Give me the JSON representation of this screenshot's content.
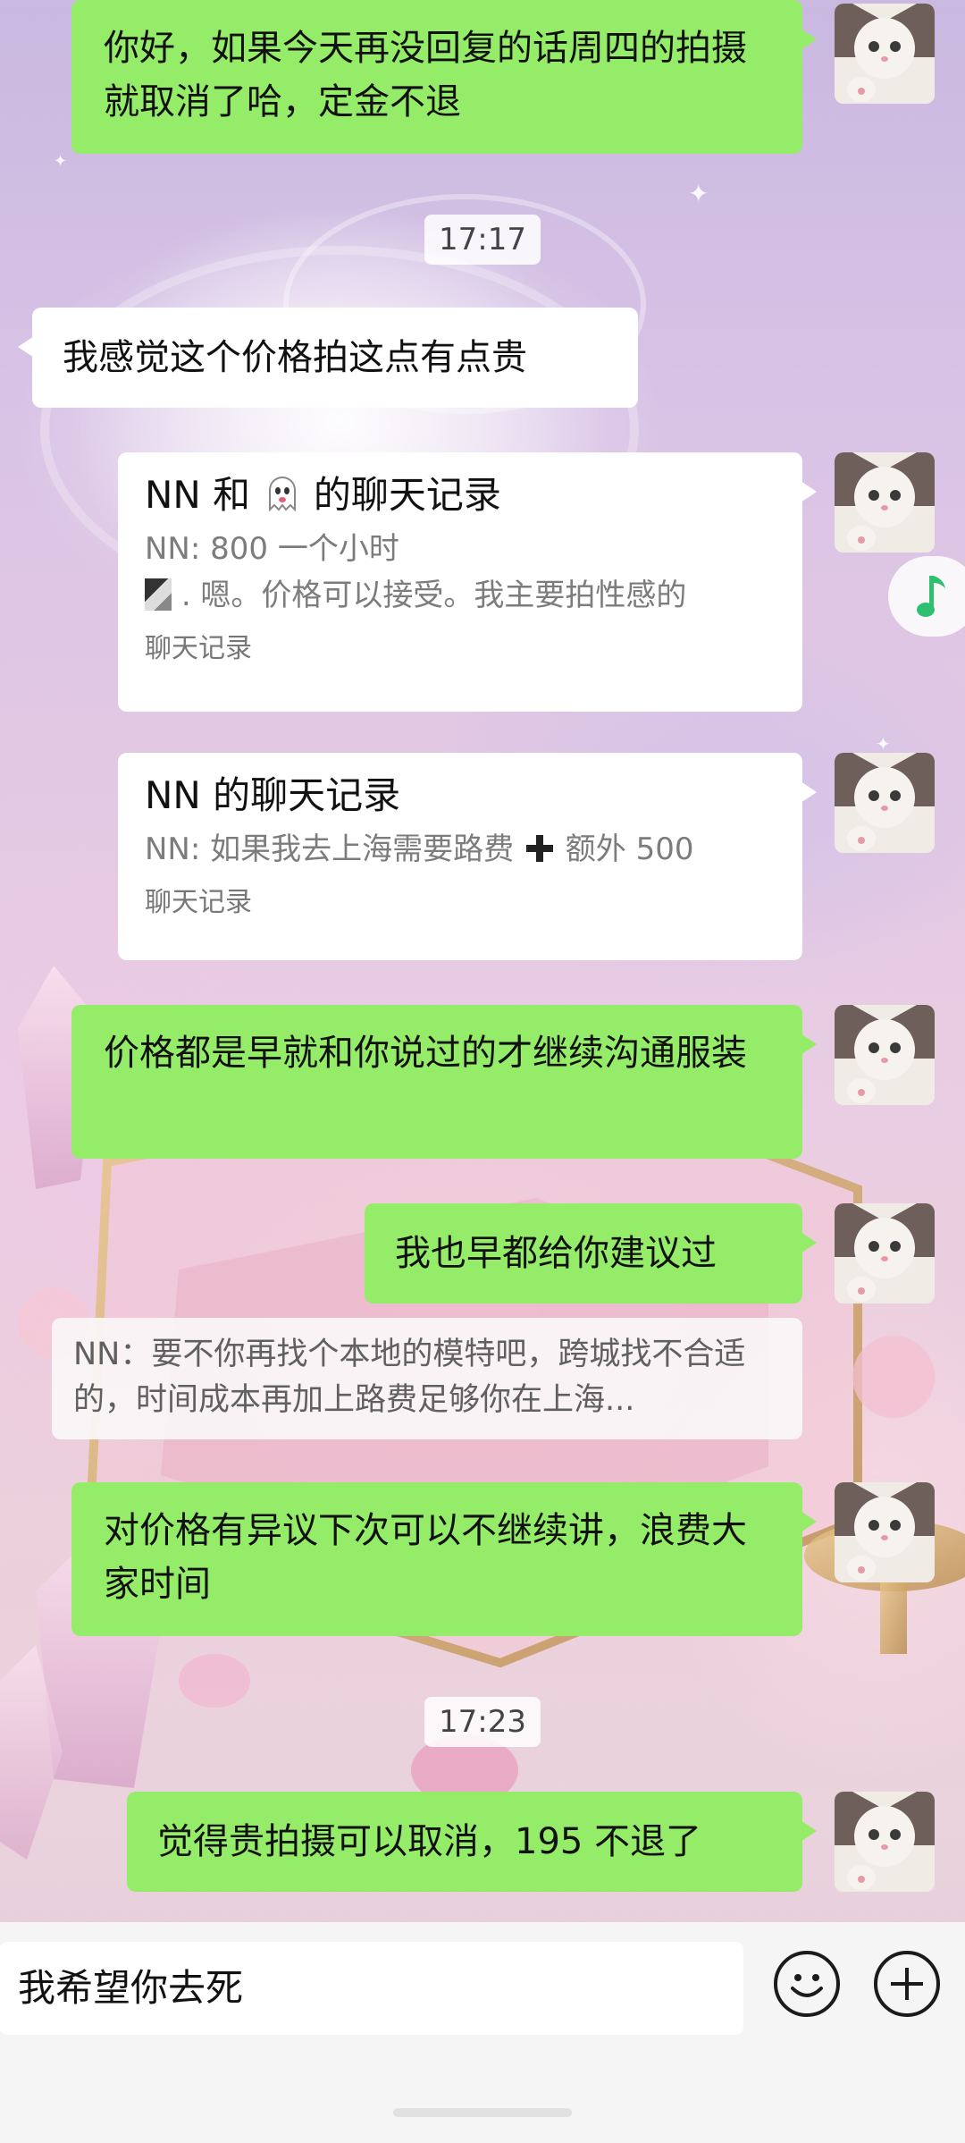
{
  "messages": {
    "m1": "你好，如果今天再没回复的话周四的拍摄就取消了哈，定金不退",
    "t1": "17:17",
    "m2": "我感觉这个价格拍这点有点贵",
    "card1": {
      "title_prefix": "NN 和",
      "title_suffix": "的聊天记录",
      "line1": "NN: 800 一个小时",
      "line2": ". 嗯。价格可以接受。我主要拍性感的",
      "foot": "聊天记录"
    },
    "card2": {
      "title": "NN 的聊天记录",
      "line1_a": "NN: 如果我去上海需要路费",
      "line1_b": "额外 500",
      "foot": "聊天记录"
    },
    "m3": "价格都是早就和你说过的才继续沟通服装",
    "m4": "我也早都给你建议过",
    "quote": "NN：要不你再找个本地的模特吧，跨城找不合适的，时间成本再加上路费足够你在上海...",
    "m5": "对价格有异议下次可以不继续讲，浪费大家时间",
    "t2": "17:23",
    "m6": "觉得贵拍摄可以取消，195 不退了"
  },
  "input": {
    "value": "我希望你去死"
  },
  "icons": {
    "emoji_button": "smiley-icon",
    "plus_button": "plus-circle-icon",
    "music": "music-note-icon",
    "ghost": "ghost-emoji-icon",
    "plus_sign": "heavy-plus-icon"
  },
  "colors": {
    "sent_bubble": "#95ec69",
    "received_bubble": "#ffffff",
    "music_note": "#2fbf71"
  }
}
